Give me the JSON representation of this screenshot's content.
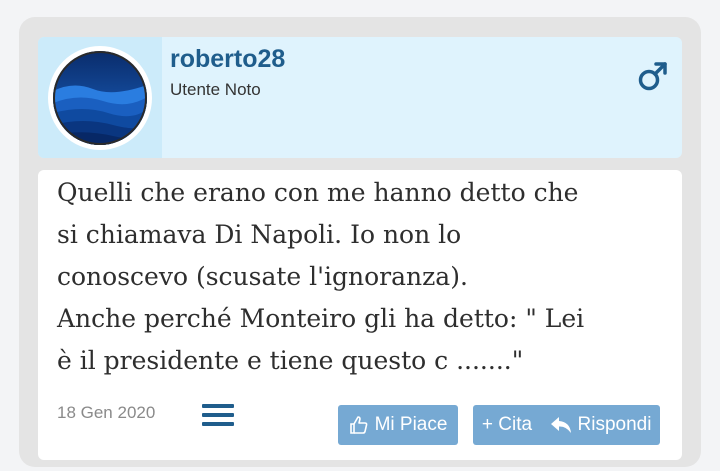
{
  "post": {
    "user": {
      "name": "roberto28",
      "title": "Utente Noto",
      "gender_icon": "male-icon"
    },
    "lines": [
      "Quelli che erano con me hanno detto che",
      "si chiamava Di Napoli. Io non lo",
      "conoscevo (scusate l'ignoranza).",
      "Anche perché Monteiro gli ha detto: \" Lei",
      "è il presidente e tiene questo c .......\""
    ],
    "date": "18 Gen 2020",
    "actions": {
      "like_label": "Mi Piace",
      "quote_label": "+ Cita",
      "reply_label": "Rispondi"
    }
  },
  "colors": {
    "accent": "#1f5d8c",
    "button": "#76a9d3",
    "header_bg": "#dff3fd"
  }
}
